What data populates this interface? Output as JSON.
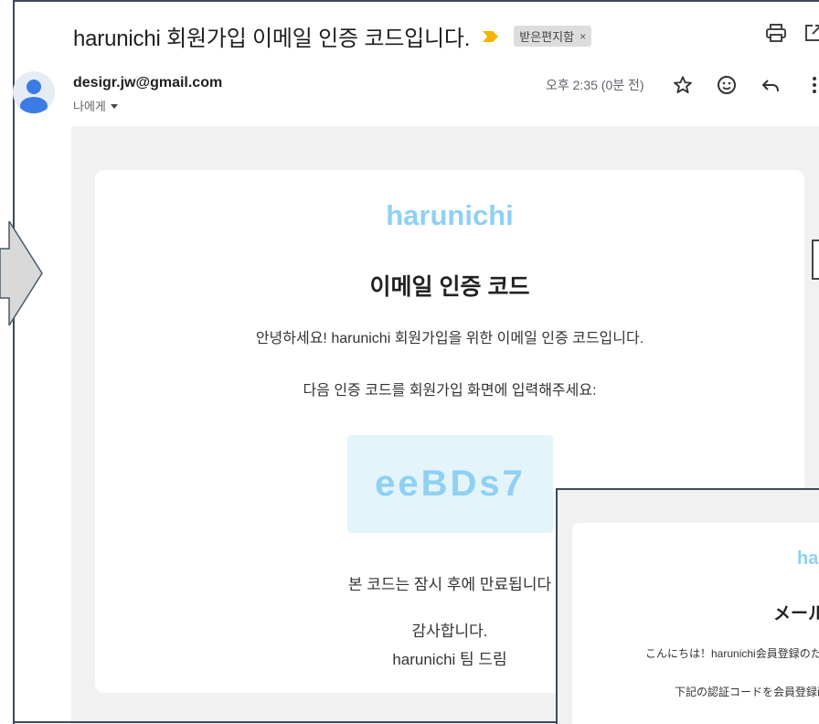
{
  "email": {
    "subject": "harunichi 회원가입 이메일 인증 코드입니다.",
    "label": "받은편지함",
    "label_close": "×",
    "sender": "desigr.jw@gmail.com",
    "recipient": "나에게",
    "time": "오후 2:35 (0분 전)"
  },
  "body": {
    "brand": "harunichi",
    "title": "이메일 인증 코드",
    "greeting": "안녕하세요! harunichi 회원가입을 위한 이메일 인증 코드입니다.",
    "instruction": "다음 인증 코드를 회원가입 화면에 입력해주세요:",
    "code": "eeBDs7",
    "expire": "본 코드는 잠시 후에 만료됩니다",
    "thanks": "감사합니다.",
    "signature": "harunichi 팀 드림"
  },
  "overlay": {
    "brand": "harunichi",
    "title": "メールアドレス認証コード",
    "greeting": "こんにちは！harunichi会員登録のためのメール認証コードです。",
    "instruction": "下記の認証コードを会員登録画面に入力してください。"
  },
  "icons": {
    "important": "important-marker-icon",
    "print": "print-icon",
    "popout": "open-in-new-window-icon",
    "star": "star-icon",
    "emoji": "emoji-reaction-icon",
    "reply": "reply-icon",
    "more": "more-vertical-icon",
    "dropdown": "chevron-down-icon",
    "arrow": "right-arrow-icon"
  },
  "colors": {
    "brand": "#8fd0f4",
    "code_bg": "#e3f4fa",
    "important": "#f4b400",
    "mail_bg": "#f1f1f1"
  }
}
